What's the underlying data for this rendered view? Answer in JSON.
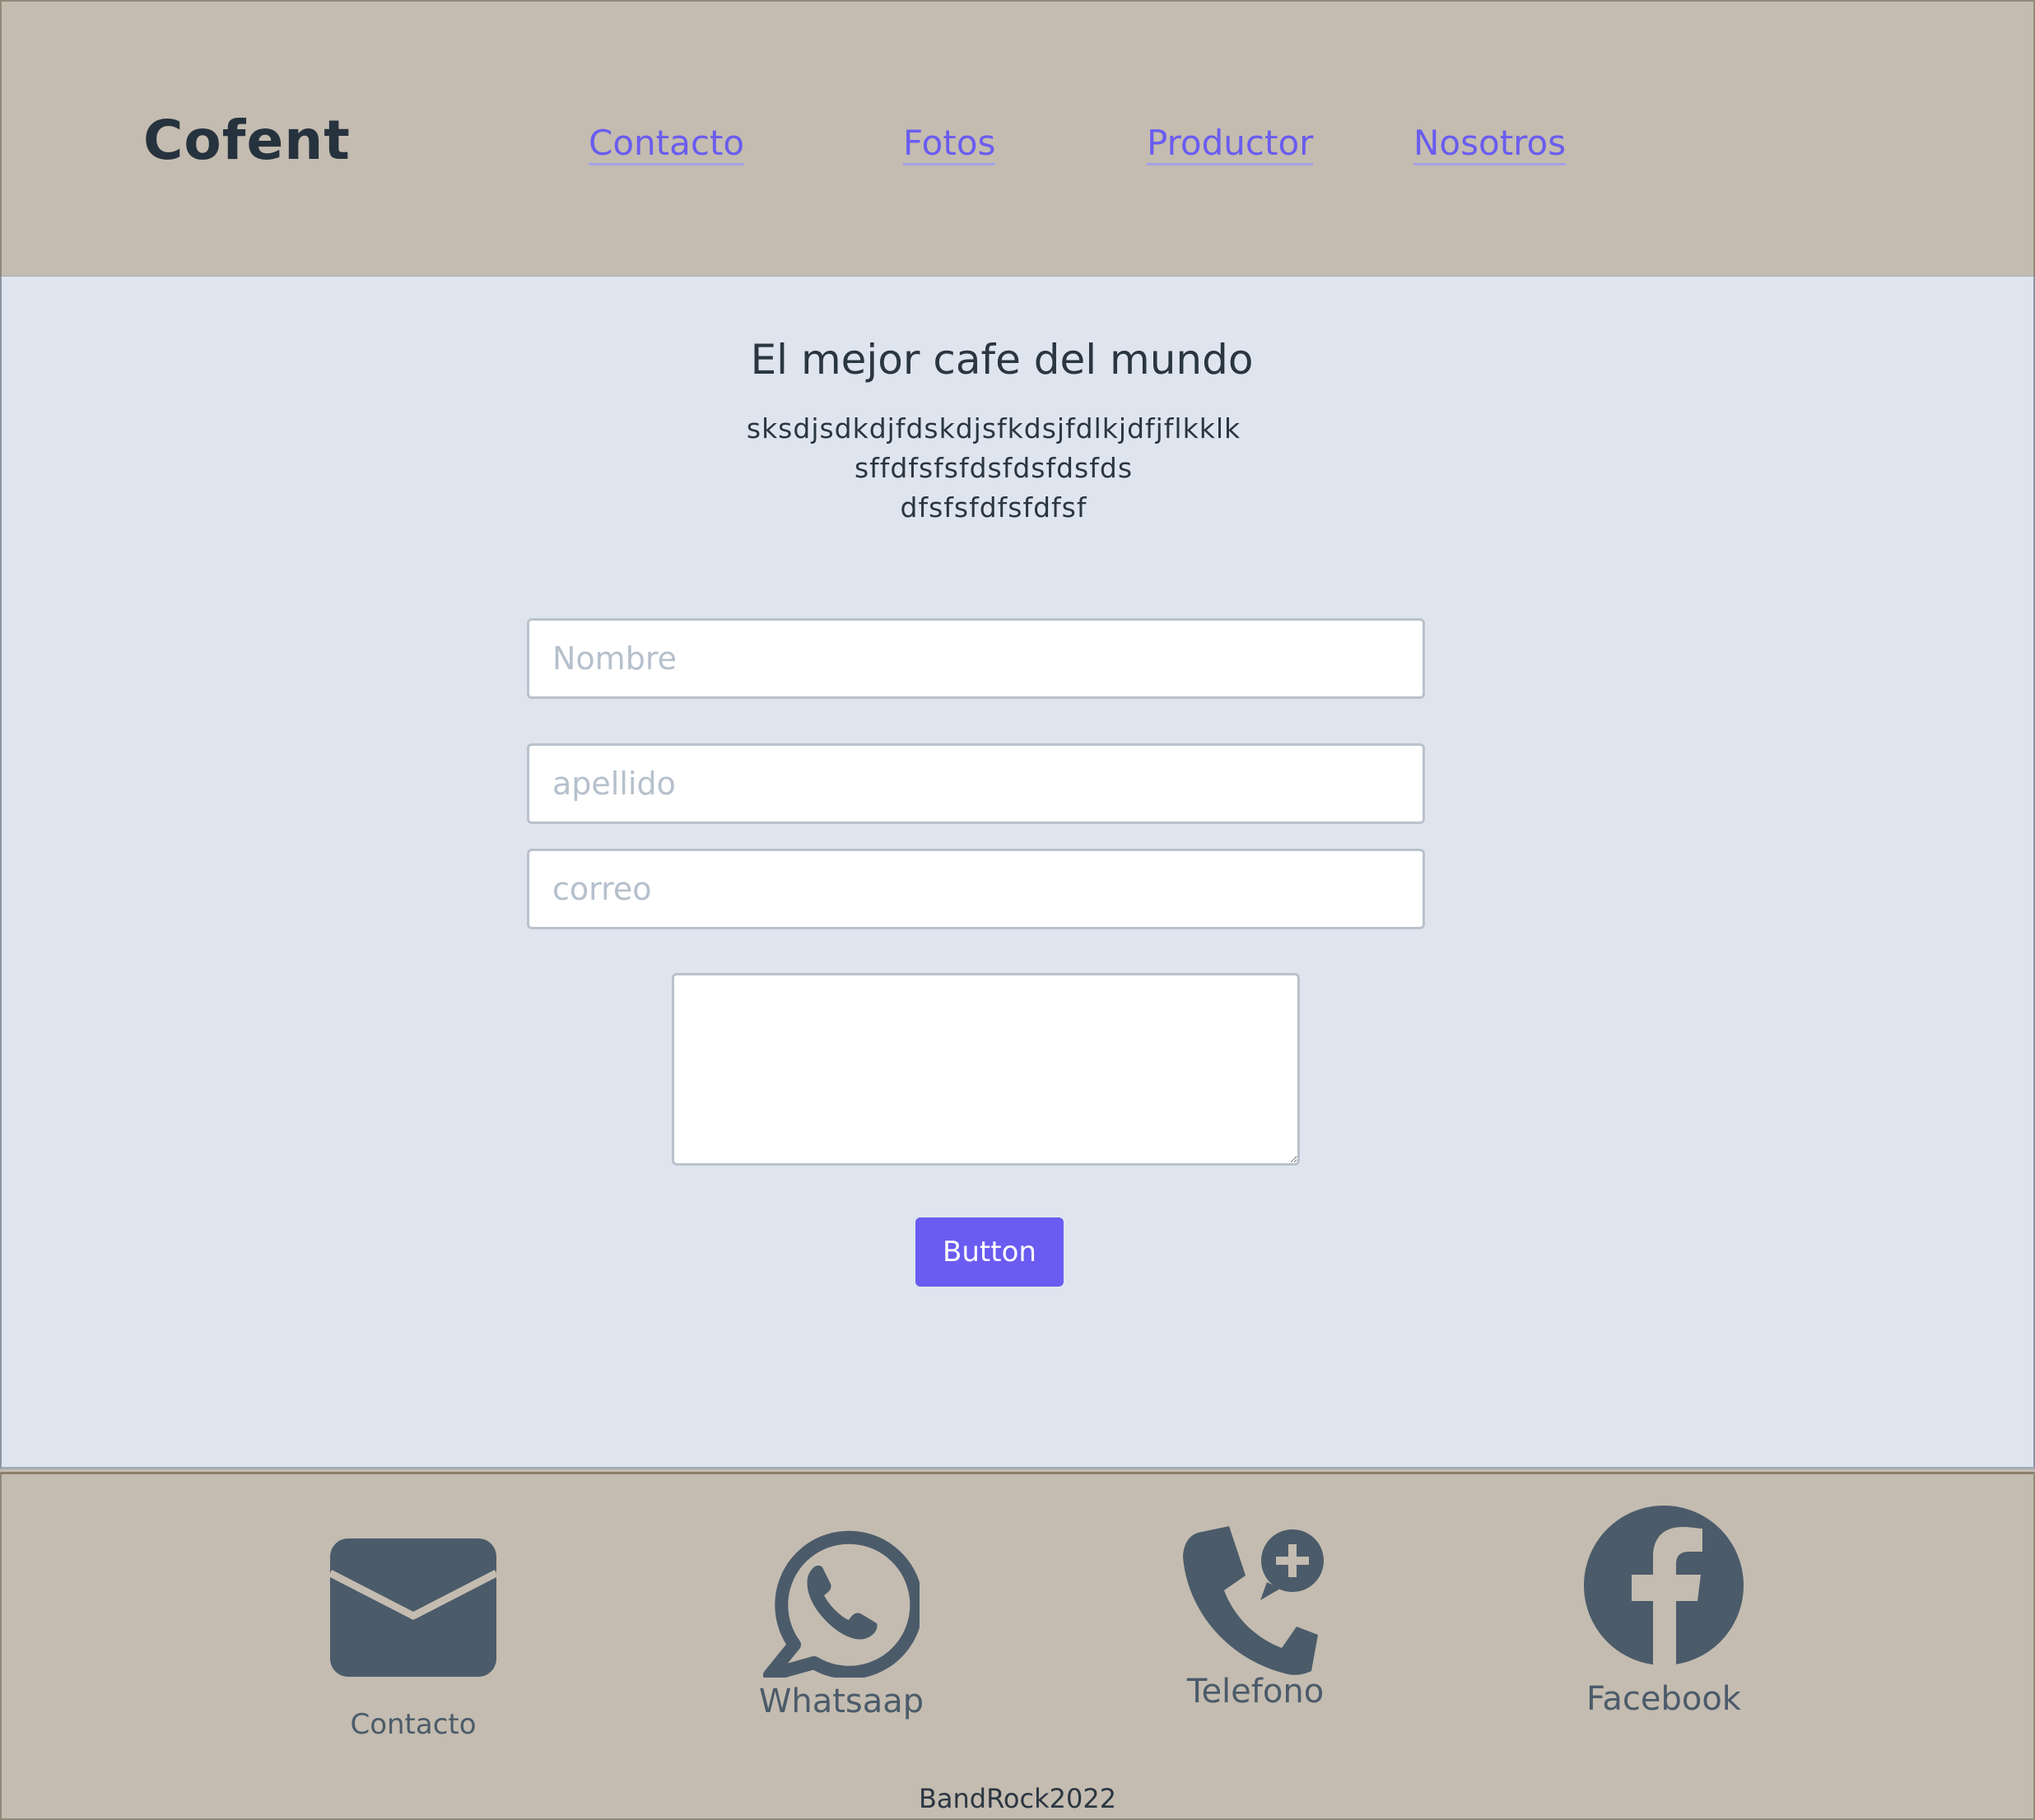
{
  "header": {
    "brand": "Cofent",
    "nav": [
      {
        "label": "Contacto"
      },
      {
        "label": "Fotos"
      },
      {
        "label": "Productor"
      },
      {
        "label": "Nosotros"
      }
    ]
  },
  "main": {
    "headline": "El mejor cafe del mundo",
    "body_lines": [
      "sksdjsdkdjfdskdjsfkdsjfdlkjdfjflkklk",
      "sffdfsfsfdsfdsfdsfds",
      "dfsfsfdfsfdfsf"
    ],
    "form": {
      "nombre_placeholder": "Nombre",
      "apellido_placeholder": "apellido",
      "correo_placeholder": "correo",
      "message_value": "",
      "button_label": "Button"
    }
  },
  "footer": {
    "social": [
      {
        "label": "Contacto",
        "icon": "envelope-icon"
      },
      {
        "label": "Whatsaap",
        "icon": "whatsapp-icon"
      },
      {
        "label": "Telefono",
        "icon": "phone-plus-icon"
      },
      {
        "label": "Facebook",
        "icon": "facebook-icon"
      }
    ],
    "copyright": "BandRock2022"
  },
  "colors": {
    "header_bg": "#c4bcb0",
    "main_bg": "#dfe5ee",
    "accent": "#6a5cf0",
    "icon": "#4b5b6a",
    "text_dark": "#26323e"
  }
}
